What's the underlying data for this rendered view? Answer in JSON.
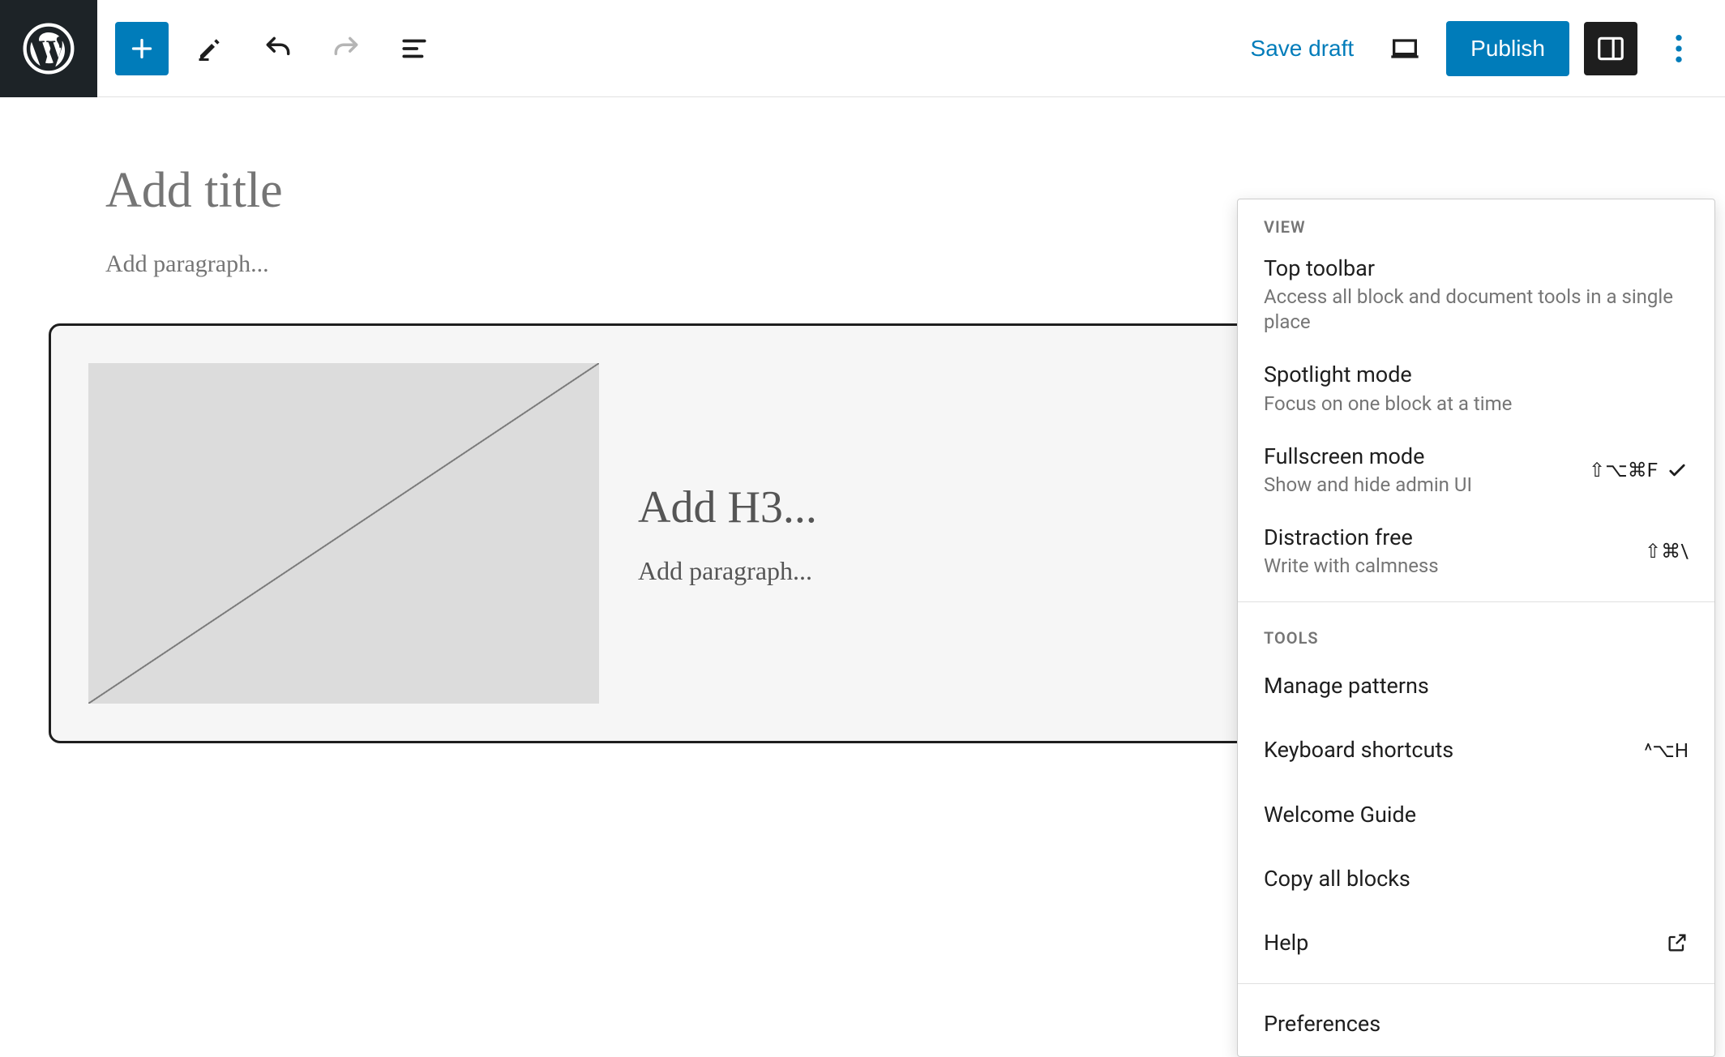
{
  "header": {
    "save_draft": "Save draft",
    "publish": "Publish"
  },
  "editor": {
    "title_placeholder": "Add title",
    "paragraph_placeholder": "Add paragraph...",
    "block": {
      "h3_placeholder": "Add H3...",
      "paragraph_placeholder": "Add paragraph..."
    }
  },
  "menu": {
    "sections": {
      "view": "VIEW",
      "tools": "TOOLS"
    },
    "view_items": [
      {
        "title": "Top toolbar",
        "desc": "Access all block and document tools in a single place",
        "shortcut": "",
        "checked": false
      },
      {
        "title": "Spotlight mode",
        "desc": "Focus on one block at a time",
        "shortcut": "",
        "checked": false
      },
      {
        "title": "Fullscreen mode",
        "desc": "Show and hide admin UI",
        "shortcut": "⇧⌥⌘F",
        "checked": true
      },
      {
        "title": "Distraction free",
        "desc": "Write with calmness",
        "shortcut": "⇧⌘\\",
        "checked": false
      }
    ],
    "tools_items": [
      {
        "title": "Manage patterns",
        "shortcut": "",
        "external": false
      },
      {
        "title": "Keyboard shortcuts",
        "shortcut": "^⌥H",
        "external": false
      },
      {
        "title": "Welcome Guide",
        "shortcut": "",
        "external": false
      },
      {
        "title": "Copy all blocks",
        "shortcut": "",
        "external": false
      },
      {
        "title": "Help",
        "shortcut": "",
        "external": true
      }
    ],
    "preferences": "Preferences"
  }
}
